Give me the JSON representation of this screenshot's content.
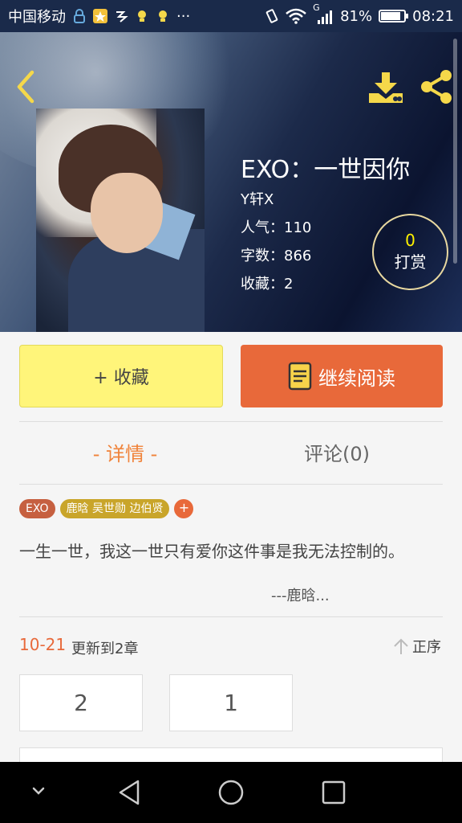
{
  "status_bar": {
    "carrier": "中国移动",
    "dots": "···",
    "signal_label": "G",
    "battery": "81%",
    "battery_level": 0.81,
    "time": "08:21"
  },
  "book": {
    "title": "EXO：一世因你",
    "author": "Y轩X",
    "popularity": "人气：110",
    "words": "字数：866",
    "favorites": "收藏：2",
    "tip_count": "0",
    "tip_label": "打赏"
  },
  "actions": {
    "collect_label": "+ 收藏",
    "read_label": "继续阅读"
  },
  "tabs": {
    "detail": "- 详情 -",
    "comments": "评论(0)"
  },
  "tags": [
    "EXO",
    "鹿晗 吴世勋 边伯贤",
    "+"
  ],
  "description": "一生一世，我这一世只有爱你这件事是我无法控制的。",
  "signature": "---鹿晗...",
  "update": {
    "date": "10-21",
    "text": "更新到2章",
    "sort_label": "正序"
  },
  "chapters": [
    "2",
    "1"
  ],
  "colors": {
    "accent": "#e8693a",
    "collect_button": "#fff57a",
    "tip_count": "#fff200",
    "icon_yellow": "#f5d84a"
  },
  "icons": {
    "back": "back-arrow-icon",
    "download": "download-icon",
    "share": "share-icon",
    "read": "book-icon",
    "sort": "up-arrow-icon"
  }
}
